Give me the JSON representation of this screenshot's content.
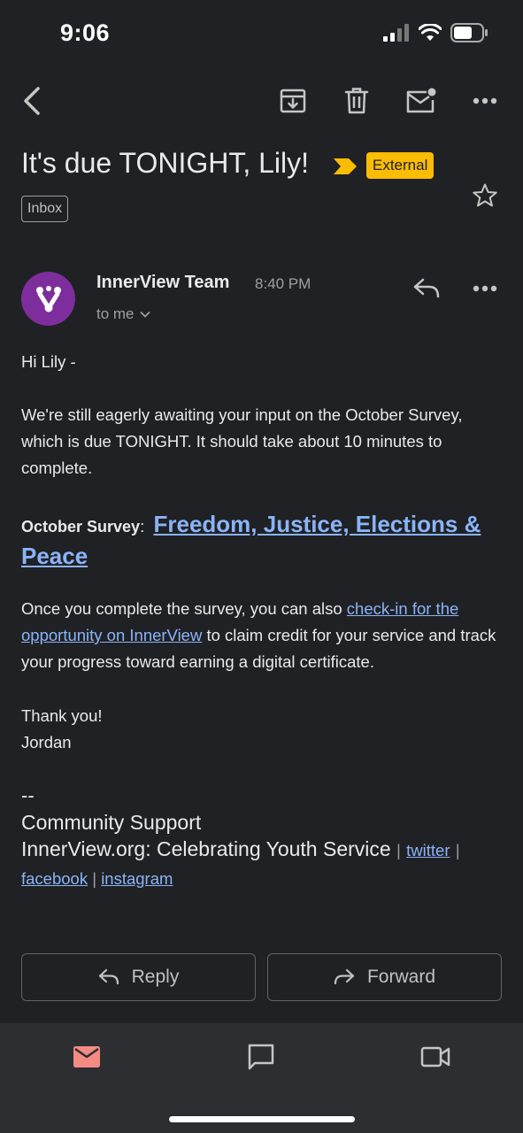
{
  "status_bar": {
    "time": "9:06"
  },
  "email": {
    "subject": "It's due TONIGHT,  Lily!",
    "external_label": "External",
    "label_chip": "Inbox",
    "sender": "InnerView Team",
    "time": "8:40 PM",
    "recipient": "to me",
    "greeting": "Hi Lily -",
    "paragraph1": "We're still eagerly awaiting your input on the October Survey, which is due TONIGHT. It should take about 10 minutes to complete.",
    "survey_label": "October Survey",
    "survey_colon": ":",
    "survey_link": "Freedom, Justice, Elections & Peace",
    "paragraph3_before": "Once you complete the survey, you can also ",
    "paragraph3_link": "check-in for the opportunity on InnerView",
    "paragraph3_after": " to claim credit for your service and track your progress toward earning a digital certificate.",
    "thanks": "Thank you!",
    "signer": "Jordan",
    "sig_dashes": "--",
    "sig_line1": "Community Support",
    "sig_line2": "InnerView.org: Celebrating Youth Service",
    "sig_sep": "|",
    "link_twitter": "twitter",
    "link_facebook": "facebook",
    "link_instagram": "instagram"
  },
  "actions": {
    "reply": "Reply",
    "forward": "Forward"
  },
  "colors": {
    "background": "#202124",
    "accent_link": "#8ab4f8",
    "external_badge": "#fbbc04",
    "avatar": "#7d2e9c",
    "mail_nav_active": "#f28b82"
  },
  "icons": {
    "toolbar": [
      "back-arrow-icon",
      "archive-icon",
      "trash-icon",
      "mark-unread-icon",
      "more-icon"
    ],
    "nav": [
      "mail-icon",
      "chat-icon",
      "meet-icon"
    ]
  }
}
